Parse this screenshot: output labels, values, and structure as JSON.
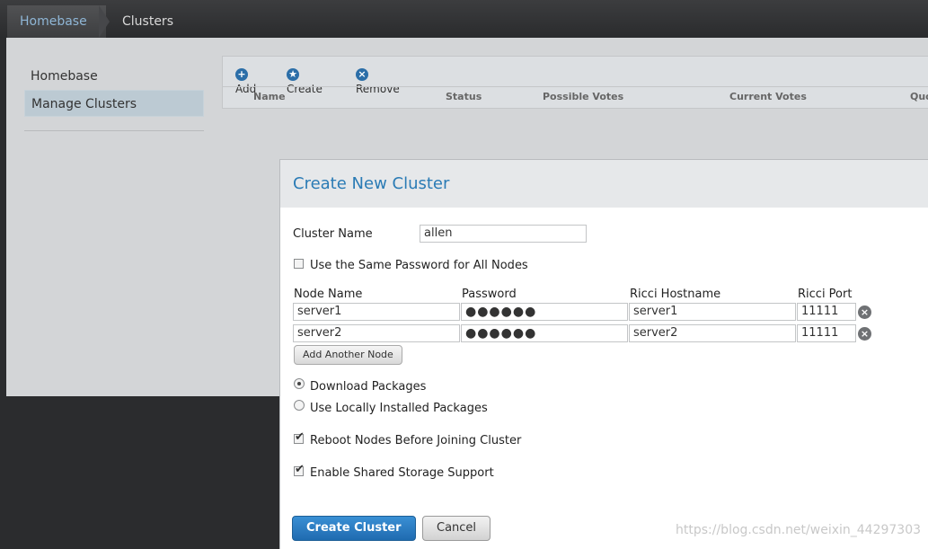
{
  "breadcrumb": {
    "home": "Homebase",
    "current": "Clusters"
  },
  "sidebar": {
    "items": [
      {
        "label": "Homebase"
      },
      {
        "label": "Manage Clusters"
      }
    ]
  },
  "toolbar": {
    "add": "Add",
    "create": "Create",
    "remove": "Remove"
  },
  "table": {
    "columns": [
      "Name",
      "Status",
      "Possible Votes",
      "Current Votes",
      "Quo"
    ]
  },
  "dialog": {
    "title": "Create New Cluster",
    "cluster_name_label": "Cluster Name",
    "cluster_name_value": "allen",
    "same_password_label": "Use the Same Password for All Nodes",
    "node_headers": {
      "node_name": "Node Name",
      "password": "Password",
      "ricci_hostname": "Ricci Hostname",
      "ricci_port": "Ricci Port"
    },
    "nodes": [
      {
        "node_name": "server1",
        "password": "●●●●●●",
        "ricci_hostname": "server1",
        "ricci_port": "11111"
      },
      {
        "node_name": "server2",
        "password": "●●●●●●",
        "ricci_hostname": "server2",
        "ricci_port": "11111"
      }
    ],
    "add_node_button": "Add Another Node",
    "download_packages": "Download Packages",
    "local_packages": "Use Locally Installed Packages",
    "reboot_nodes": "Reboot Nodes Before Joining Cluster",
    "shared_storage": "Enable Shared Storage Support",
    "create_button": "Create Cluster",
    "cancel_button": "Cancel"
  },
  "watermark": "https://blog.csdn.net/weixin_44297303",
  "colors": {
    "accent": "#2a7bb5",
    "primary_button": "#1f6bb0",
    "selected_sidebar": "#bccad3"
  }
}
